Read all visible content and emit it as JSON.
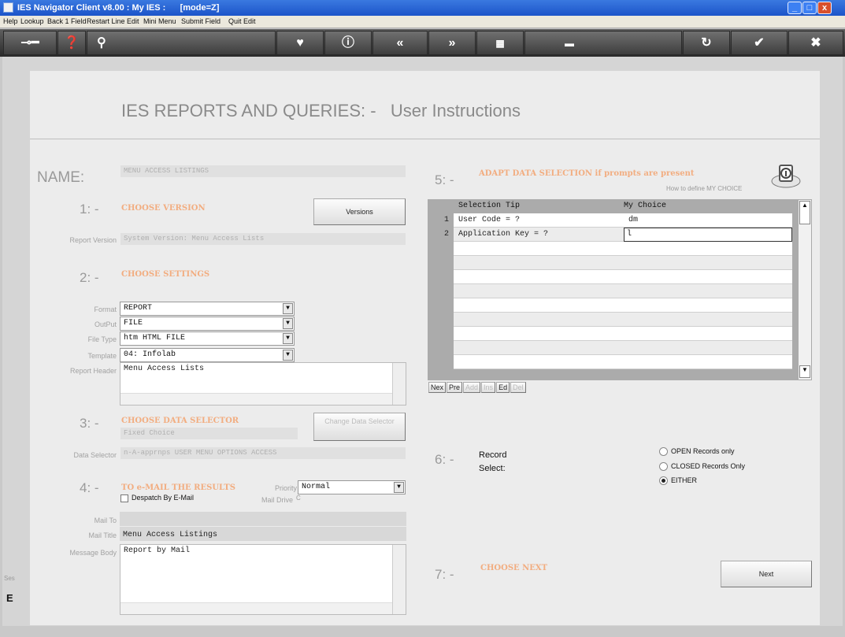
{
  "window": {
    "title": "IES Navigator Client v8.00 : My IES :      [mode=Z]",
    "controls": [
      "_",
      "□",
      "x"
    ]
  },
  "menu": [
    "Help",
    "Lookup",
    "Back 1 Field",
    "Restart Line Edit",
    "Mini Menu",
    "Submit Field",
    "Quit Edit"
  ],
  "toolbar": {
    "icons": [
      "key-icon",
      "help-icon",
      "search-icon",
      "heart-icon",
      "info-icon",
      "rewind-icon",
      "forward-icon",
      "calendar-icon",
      "printer-icon",
      "refresh-icon",
      "check-icon",
      "close-icon"
    ]
  },
  "heading": "IES REPORTS AND QUERIES: -   User Instructions",
  "name": {
    "label": "NAME:",
    "value": "MENU ACCESS LISTINGS"
  },
  "s1": {
    "num": "1: -",
    "title": "CHOOSE VERSION",
    "button": "Versions",
    "report_version_label": "Report Version",
    "report_version_value": "System Version: Menu Access Lists"
  },
  "s2": {
    "num": "2: -",
    "title": "CHOOSE SETTINGS",
    "format_label": "Format",
    "format_value": "REPORT",
    "output_label": "OutPut",
    "output_value": "FILE",
    "filetype_label": "File Type",
    "filetype_value": "htm HTML FILE",
    "template_label": "Template",
    "template_value": "04: Infolab",
    "header_label": "Report Header",
    "header_value": "Menu Access Lists"
  },
  "s3": {
    "num": "3: -",
    "title": "CHOOSE DATA SELECTOR",
    "selector_value": "Fixed Choice",
    "button": "Change Data Selector",
    "data_selector_label": "Data Selector",
    "data_selector_value": "n-A-apprnps USER MENU OPTIONS ACCESS"
  },
  "s4": {
    "num": "4: -",
    "title": "TO e-MAIL THE RESULTS",
    "priority_label": "Priority",
    "priority_value": "Normal",
    "despatch_label": "Despatch By E-Mail",
    "mail_drive_label": "Mail Drive",
    "mail_drive_value": "C",
    "mail_to_label": "Mail To",
    "mail_title_label": "Mail Title",
    "mail_title_value": "Menu Access Listings",
    "message_body_label": "Message Body",
    "message_body_value": "Report by Mail"
  },
  "s5": {
    "num": "5: -",
    "title": "ADAPT DATA SELECTION if prompts are present",
    "how_to": "How to define MY CHOICE",
    "col_tip": "Selection Tip",
    "col_choice": "My Choice",
    "rows": [
      {
        "n": "1",
        "tip": "User Code = ?",
        "choice": "dm"
      },
      {
        "n": "2",
        "tip": "Application Key = ?",
        "choice": "l"
      }
    ],
    "nav": [
      "Nex",
      "Pre",
      "Add",
      "Ins",
      "Ed",
      "Del"
    ]
  },
  "s6": {
    "num": "6: -",
    "label1": "Record",
    "label2": "Select:",
    "options": [
      "OPEN Records only",
      "CLOSED Records Only",
      "EITHER"
    ],
    "selected": 2
  },
  "s7": {
    "num": "7: -",
    "title": "CHOOSE NEXT",
    "button": "Next"
  },
  "left_edge": {
    "text": "E",
    "tiny": "Ses"
  }
}
